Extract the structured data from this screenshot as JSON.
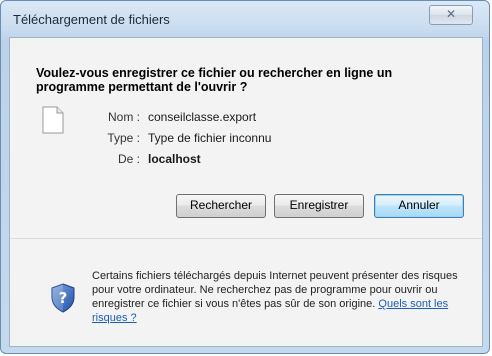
{
  "window": {
    "title": "Téléchargement de fichiers",
    "close_glyph": "✕"
  },
  "dialog": {
    "question": "Voulez-vous enregistrer ce fichier ou rechercher en ligne un programme permettant de l'ouvrir ?",
    "fields": {
      "name_label": "Nom :",
      "name_value": "conseilclasse.export",
      "type_label": "Type :",
      "type_value": "Type de fichier inconnu",
      "from_label": "De :",
      "from_value": "localhost"
    },
    "buttons": {
      "search": "Rechercher",
      "save": "Enregistrer",
      "cancel": "Annuler"
    },
    "info": {
      "text": "Certains fichiers téléchargés depuis Internet peuvent présenter des risques pour votre ordinateur. Ne recherchez pas de programme pour ouvrir ou enregistrer ce fichier si vous n'êtes pas sûr de son origine.",
      "link": "Quels sont les risques ?"
    }
  },
  "icons": {
    "file": "file-icon",
    "shield": "shield-icon"
  },
  "colors": {
    "link": "#1a5fb4",
    "default_button_border": "#3c7fb1"
  }
}
